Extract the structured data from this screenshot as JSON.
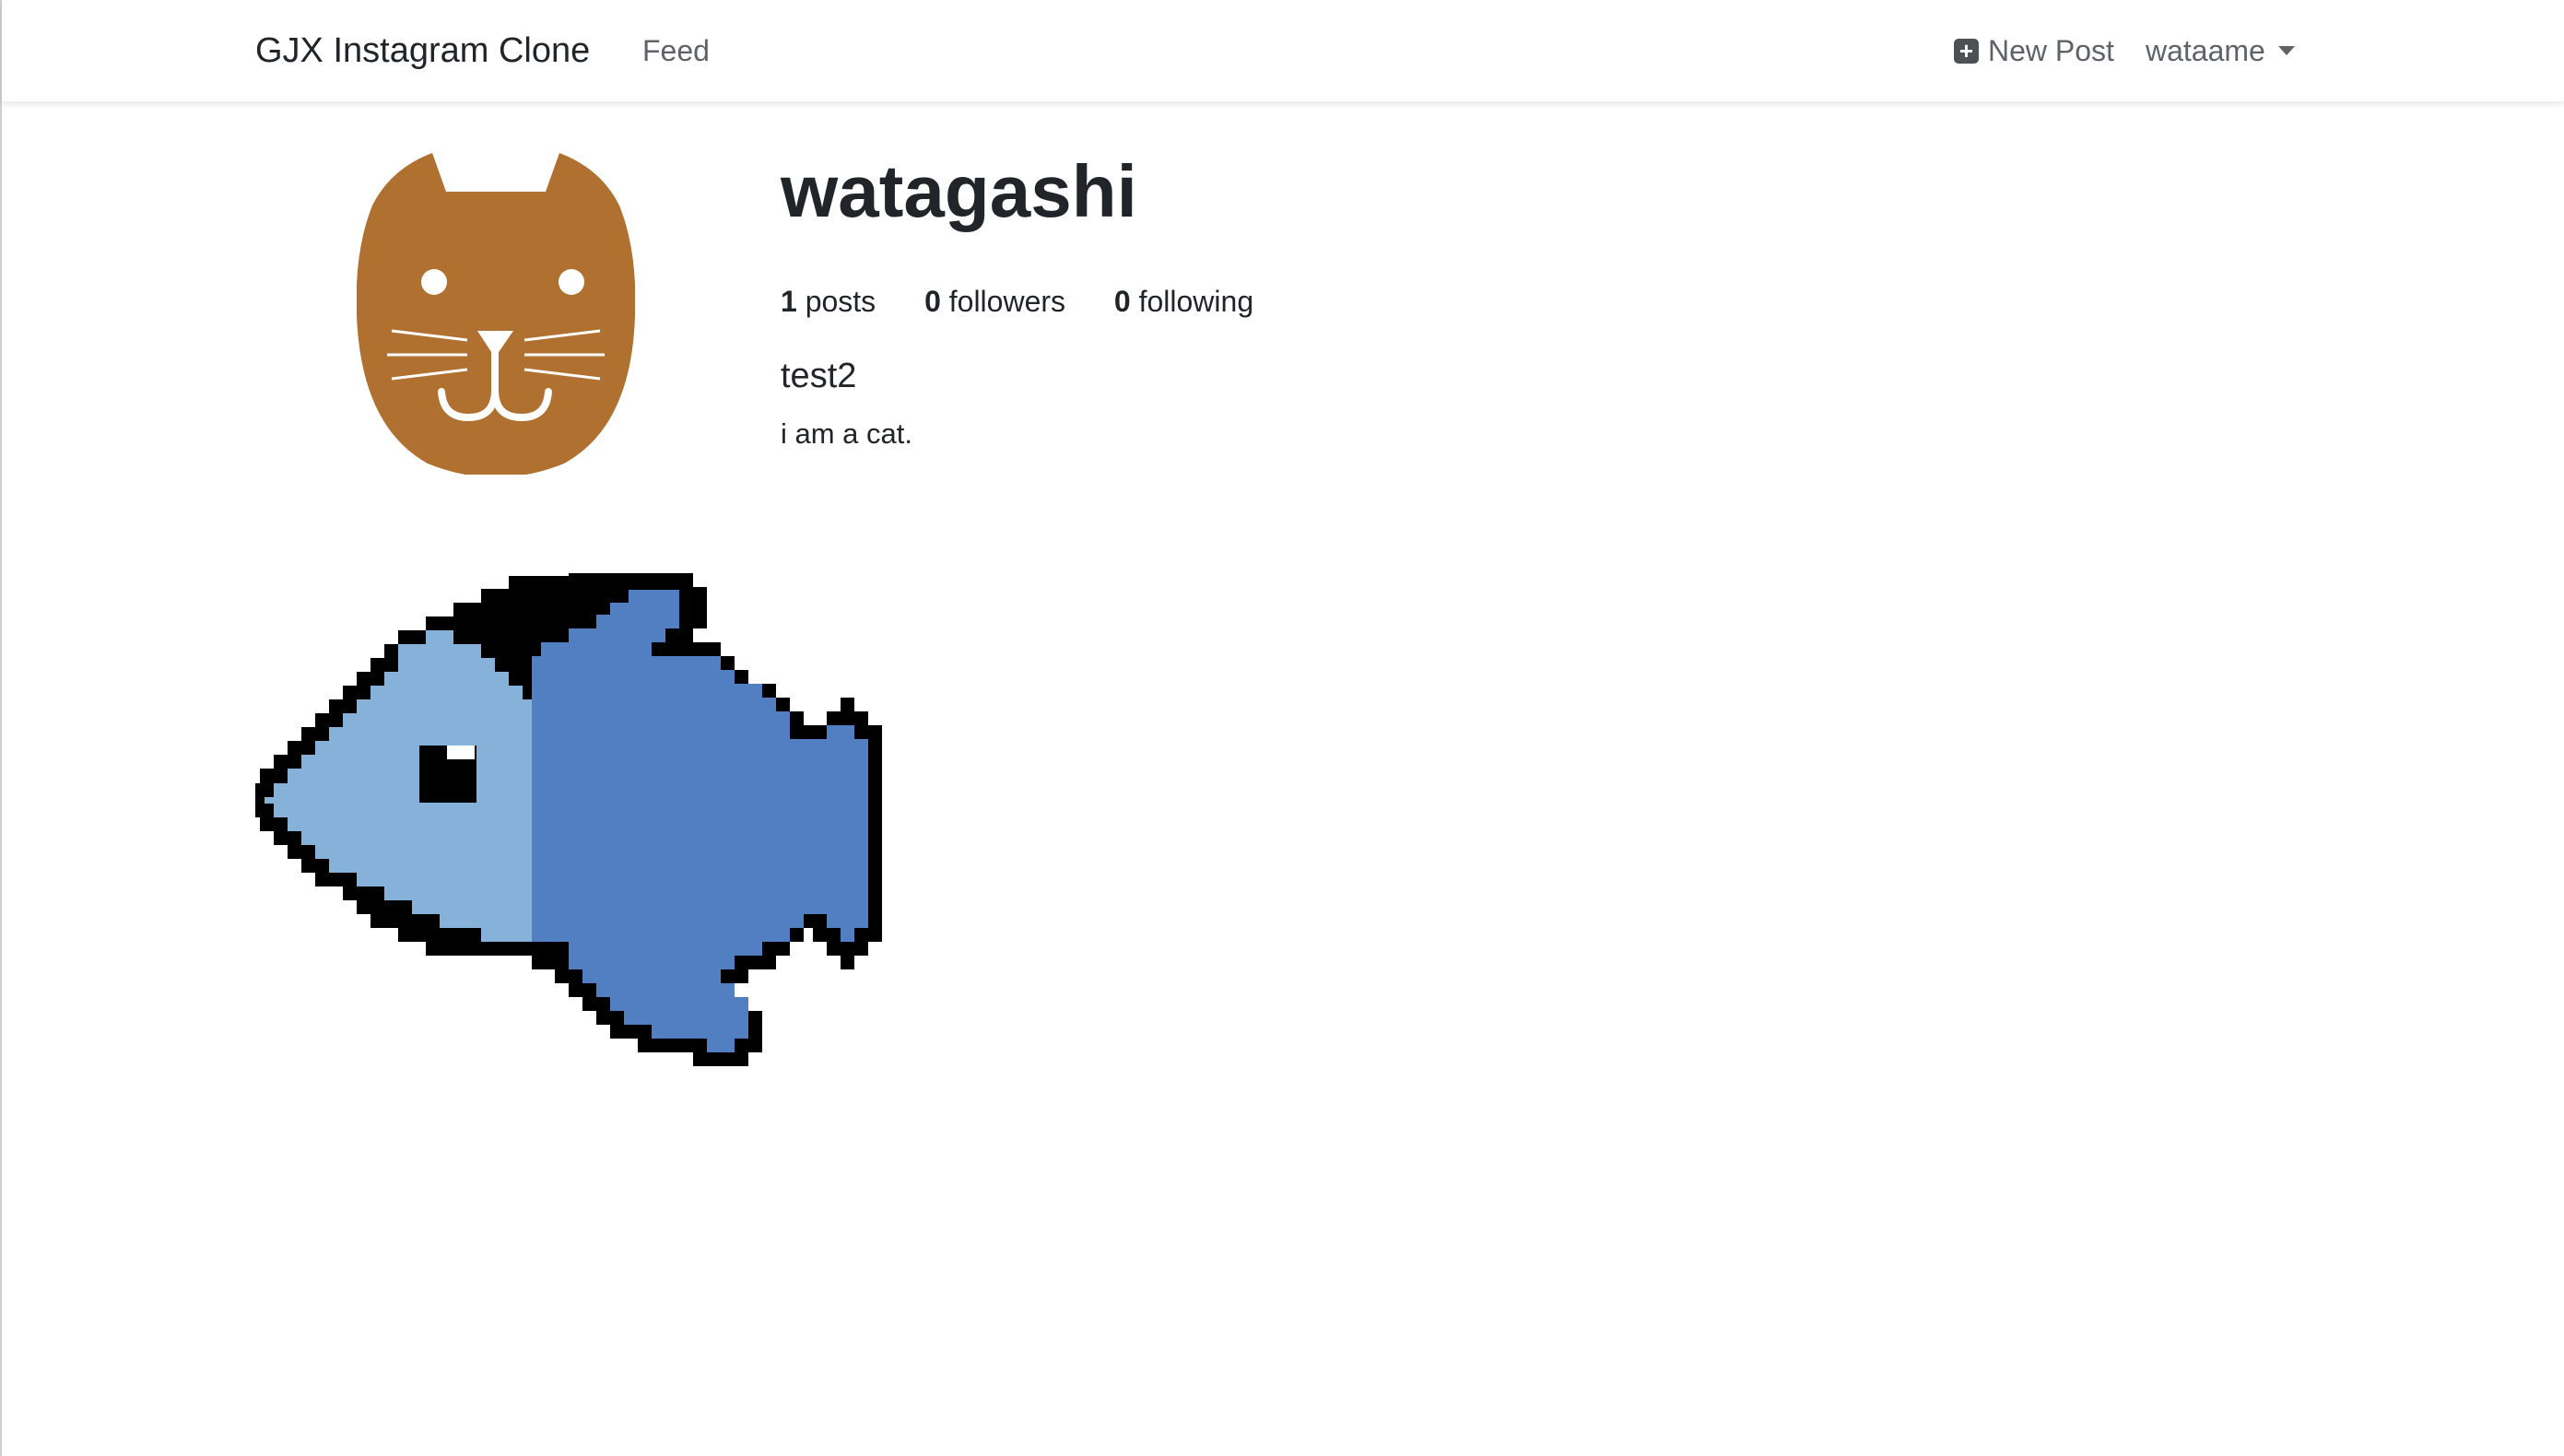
{
  "navbar": {
    "brand": "GJX Instagram Clone",
    "feed_label": "Feed",
    "new_post_label": "New Post",
    "new_post_icon": "plus-square-icon",
    "user_menu_label": "wataame",
    "user_menu_icon": "caret-down-icon"
  },
  "profile": {
    "username": "watagashi",
    "avatar_icon": "cat-icon",
    "avatar_color": "#b07030",
    "stats": {
      "posts_count": "1",
      "posts_label": "posts",
      "followers_count": "0",
      "followers_label": "followers",
      "following_count": "0",
      "following_label": "following"
    },
    "full_name": "test2",
    "bio": "i am a cat."
  },
  "posts": [
    {
      "image_icon": "pixel-fish-icon",
      "color_body": "#517fc2",
      "color_head": "#86b1d9"
    }
  ]
}
